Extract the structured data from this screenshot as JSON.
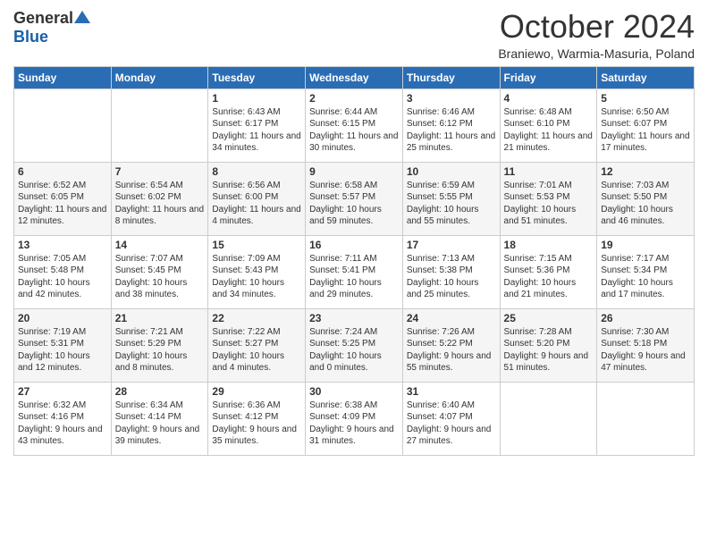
{
  "logo": {
    "general": "General",
    "blue": "Blue"
  },
  "header": {
    "month": "October 2024",
    "location": "Braniewo, Warmia-Masuria, Poland"
  },
  "weekdays": [
    "Sunday",
    "Monday",
    "Tuesday",
    "Wednesday",
    "Thursday",
    "Friday",
    "Saturday"
  ],
  "weeks": [
    [
      {
        "day": "",
        "content": ""
      },
      {
        "day": "",
        "content": ""
      },
      {
        "day": "1",
        "content": "Sunrise: 6:43 AM\nSunset: 6:17 PM\nDaylight: 11 hours\nand 34 minutes."
      },
      {
        "day": "2",
        "content": "Sunrise: 6:44 AM\nSunset: 6:15 PM\nDaylight: 11 hours\nand 30 minutes."
      },
      {
        "day": "3",
        "content": "Sunrise: 6:46 AM\nSunset: 6:12 PM\nDaylight: 11 hours\nand 25 minutes."
      },
      {
        "day": "4",
        "content": "Sunrise: 6:48 AM\nSunset: 6:10 PM\nDaylight: 11 hours\nand 21 minutes."
      },
      {
        "day": "5",
        "content": "Sunrise: 6:50 AM\nSunset: 6:07 PM\nDaylight: 11 hours\nand 17 minutes."
      }
    ],
    [
      {
        "day": "6",
        "content": "Sunrise: 6:52 AM\nSunset: 6:05 PM\nDaylight: 11 hours\nand 12 minutes."
      },
      {
        "day": "7",
        "content": "Sunrise: 6:54 AM\nSunset: 6:02 PM\nDaylight: 11 hours\nand 8 minutes."
      },
      {
        "day": "8",
        "content": "Sunrise: 6:56 AM\nSunset: 6:00 PM\nDaylight: 11 hours\nand 4 minutes."
      },
      {
        "day": "9",
        "content": "Sunrise: 6:58 AM\nSunset: 5:57 PM\nDaylight: 10 hours\nand 59 minutes."
      },
      {
        "day": "10",
        "content": "Sunrise: 6:59 AM\nSunset: 5:55 PM\nDaylight: 10 hours\nand 55 minutes."
      },
      {
        "day": "11",
        "content": "Sunrise: 7:01 AM\nSunset: 5:53 PM\nDaylight: 10 hours\nand 51 minutes."
      },
      {
        "day": "12",
        "content": "Sunrise: 7:03 AM\nSunset: 5:50 PM\nDaylight: 10 hours\nand 46 minutes."
      }
    ],
    [
      {
        "day": "13",
        "content": "Sunrise: 7:05 AM\nSunset: 5:48 PM\nDaylight: 10 hours\nand 42 minutes."
      },
      {
        "day": "14",
        "content": "Sunrise: 7:07 AM\nSunset: 5:45 PM\nDaylight: 10 hours\nand 38 minutes."
      },
      {
        "day": "15",
        "content": "Sunrise: 7:09 AM\nSunset: 5:43 PM\nDaylight: 10 hours\nand 34 minutes."
      },
      {
        "day": "16",
        "content": "Sunrise: 7:11 AM\nSunset: 5:41 PM\nDaylight: 10 hours\nand 29 minutes."
      },
      {
        "day": "17",
        "content": "Sunrise: 7:13 AM\nSunset: 5:38 PM\nDaylight: 10 hours\nand 25 minutes."
      },
      {
        "day": "18",
        "content": "Sunrise: 7:15 AM\nSunset: 5:36 PM\nDaylight: 10 hours\nand 21 minutes."
      },
      {
        "day": "19",
        "content": "Sunrise: 7:17 AM\nSunset: 5:34 PM\nDaylight: 10 hours\nand 17 minutes."
      }
    ],
    [
      {
        "day": "20",
        "content": "Sunrise: 7:19 AM\nSunset: 5:31 PM\nDaylight: 10 hours\nand 12 minutes."
      },
      {
        "day": "21",
        "content": "Sunrise: 7:21 AM\nSunset: 5:29 PM\nDaylight: 10 hours\nand 8 minutes."
      },
      {
        "day": "22",
        "content": "Sunrise: 7:22 AM\nSunset: 5:27 PM\nDaylight: 10 hours\nand 4 minutes."
      },
      {
        "day": "23",
        "content": "Sunrise: 7:24 AM\nSunset: 5:25 PM\nDaylight: 10 hours\nand 0 minutes."
      },
      {
        "day": "24",
        "content": "Sunrise: 7:26 AM\nSunset: 5:22 PM\nDaylight: 9 hours\nand 55 minutes."
      },
      {
        "day": "25",
        "content": "Sunrise: 7:28 AM\nSunset: 5:20 PM\nDaylight: 9 hours\nand 51 minutes."
      },
      {
        "day": "26",
        "content": "Sunrise: 7:30 AM\nSunset: 5:18 PM\nDaylight: 9 hours\nand 47 minutes."
      }
    ],
    [
      {
        "day": "27",
        "content": "Sunrise: 6:32 AM\nSunset: 4:16 PM\nDaylight: 9 hours\nand 43 minutes."
      },
      {
        "day": "28",
        "content": "Sunrise: 6:34 AM\nSunset: 4:14 PM\nDaylight: 9 hours\nand 39 minutes."
      },
      {
        "day": "29",
        "content": "Sunrise: 6:36 AM\nSunset: 4:12 PM\nDaylight: 9 hours\nand 35 minutes."
      },
      {
        "day": "30",
        "content": "Sunrise: 6:38 AM\nSunset: 4:09 PM\nDaylight: 9 hours\nand 31 minutes."
      },
      {
        "day": "31",
        "content": "Sunrise: 6:40 AM\nSunset: 4:07 PM\nDaylight: 9 hours\nand 27 minutes."
      },
      {
        "day": "",
        "content": ""
      },
      {
        "day": "",
        "content": ""
      }
    ]
  ]
}
